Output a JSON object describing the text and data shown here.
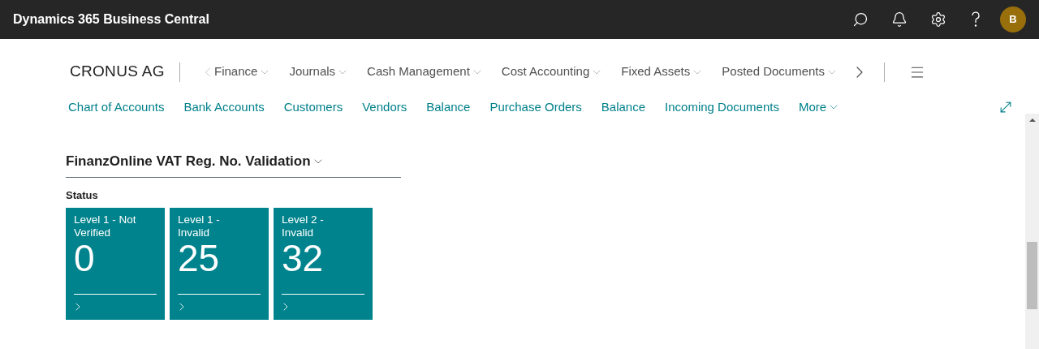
{
  "app_title": "Dynamics 365 Business Central",
  "user_initial": "B",
  "company": "CRONUS AG",
  "menus": [
    {
      "label": "Finance"
    },
    {
      "label": "Journals"
    },
    {
      "label": "Cash Management"
    },
    {
      "label": "Cost Accounting"
    },
    {
      "label": "Fixed Assets"
    },
    {
      "label": "Posted Documents"
    }
  ],
  "links": [
    {
      "label": "Chart of Accounts",
      "kind": "link"
    },
    {
      "label": "Bank Accounts",
      "kind": "link"
    },
    {
      "label": "Customers",
      "kind": "link"
    },
    {
      "label": "Vendors",
      "kind": "link"
    },
    {
      "label": "Balance",
      "kind": "link"
    },
    {
      "label": "Purchase Orders",
      "kind": "link"
    },
    {
      "label": "Balance",
      "kind": "link"
    },
    {
      "label": "Incoming Documents",
      "kind": "link"
    },
    {
      "label": "More",
      "kind": "menu"
    }
  ],
  "section": {
    "title": "FinanzOnline VAT Reg. No. Validation",
    "group": "Status",
    "tiles": [
      {
        "label": "Level 1 - Not Verified",
        "value": "0"
      },
      {
        "label": "Level 1 - Invalid",
        "value": "25"
      },
      {
        "label": "Level 2 - Invalid",
        "value": "32"
      }
    ]
  }
}
